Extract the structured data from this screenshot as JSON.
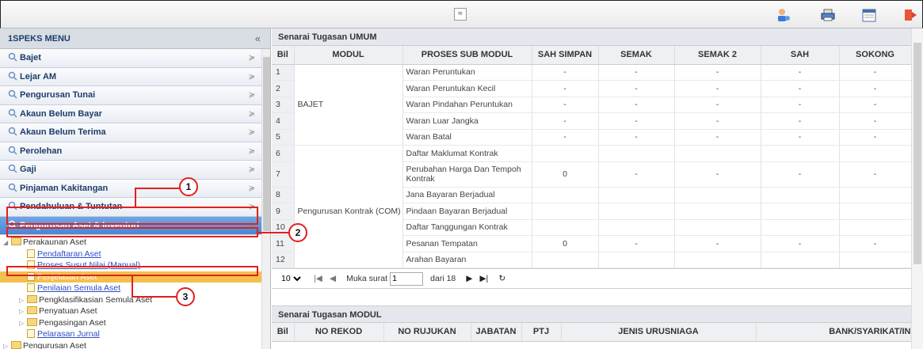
{
  "topbar": {
    "collapse_glyph": "≈",
    "icons": [
      "user-settings-icon",
      "printer-icon",
      "calendar-icon",
      "logout-icon"
    ]
  },
  "menu": {
    "title": "1SPEKS MENU",
    "collapse_glyph": "«",
    "chevron": "≽",
    "items": [
      {
        "label": "Bajet"
      },
      {
        "label": "Lejar AM"
      },
      {
        "label": "Pengurusan Tunai"
      },
      {
        "label": "Akaun Belum Bayar"
      },
      {
        "label": "Akaun Belum Terima"
      },
      {
        "label": "Perolehan"
      },
      {
        "label": "Gaji"
      },
      {
        "label": "Pinjaman Kakitangan"
      },
      {
        "label": "Pendahuluan & Tuntutan"
      },
      {
        "label": "Pengurusan Aset & Inventori",
        "active": true
      }
    ],
    "tree": [
      {
        "label": "Perakaunan Aset",
        "type": "folder",
        "level": 0,
        "open": true
      },
      {
        "label": "Pendaftaran Aset",
        "type": "link",
        "level": 1
      },
      {
        "label": "Proses Susut Nilai (Manual)",
        "type": "link",
        "level": 1
      },
      {
        "label": "Penjelasan Aset",
        "type": "link",
        "level": 1,
        "selected": true
      },
      {
        "label": "Penilaian Semula Aset",
        "type": "link",
        "level": 1
      },
      {
        "label": "Pengklasifikasian Semula Aset",
        "type": "folder",
        "level": 1
      },
      {
        "label": "Penyatuan Aset",
        "type": "folder",
        "level": 1
      },
      {
        "label": "Pengasingan Aset",
        "type": "folder",
        "level": 1
      },
      {
        "label": "Pelarasan Jurnal",
        "type": "link",
        "level": 1
      },
      {
        "label": "Pengurusan Aset",
        "type": "folder",
        "level": 0
      }
    ]
  },
  "umum": {
    "title": "Senarai Tugasan UMUM",
    "columns": [
      "Bil",
      "MODUL",
      "PROSES SUB MODUL",
      "SAH SIMPAN",
      "SEMAK",
      "SEMAK 2",
      "SAH",
      "SOKONG"
    ],
    "rows": [
      {
        "bil": "1",
        "proses": "Waran Peruntukan",
        "sah_simpan": "-",
        "semak": "-",
        "semak2": "-",
        "sah": "-",
        "sokong": "-"
      },
      {
        "bil": "2",
        "proses": "Waran Peruntukan Kecil",
        "sah_simpan": "-",
        "semak": "-",
        "semak2": "-",
        "sah": "-",
        "sokong": "-"
      },
      {
        "bil": "3",
        "modul": "BAJET",
        "proses": "Waran Pindahan Peruntukan",
        "sah_simpan": "-",
        "semak": "-",
        "semak2": "-",
        "sah": "-",
        "sokong": "-"
      },
      {
        "bil": "4",
        "proses": "Waran Luar Jangka",
        "sah_simpan": "-",
        "semak": "-",
        "semak2": "-",
        "sah": "-",
        "sokong": "-"
      },
      {
        "bil": "5",
        "proses": "Waran Batal",
        "sah_simpan": "-",
        "semak": "-",
        "semak2": "-",
        "sah": "-",
        "sokong": "-"
      },
      {
        "bil": "6",
        "proses": "Daftar Maklumat Kontrak"
      },
      {
        "bil": "7",
        "proses": "Perubahan Harga Dan Tempoh Kontrak",
        "sah_simpan": "0",
        "semak": "-",
        "semak2": "-",
        "sah": "-",
        "sokong": "-"
      },
      {
        "bil": "8",
        "proses": "Jana Bayaran Berjadual"
      },
      {
        "bil": "9",
        "modul": "Pengurusan Kontrak (COM)",
        "proses": "Pindaan Bayaran Berjadual"
      },
      {
        "bil": "10",
        "proses": "Daftar Tanggungan Kontrak"
      },
      {
        "bil": "11",
        "proses": "Pesanan Tempatan",
        "sah_simpan": "0",
        "semak": "-",
        "semak2": "-",
        "sah": "-",
        "sokong": "-"
      },
      {
        "bil": "12",
        "proses": "Arahan Bayaran"
      }
    ]
  },
  "pager": {
    "page_size": "10",
    "label_page": "Muka surat",
    "page": "1",
    "label_of": "dari 18"
  },
  "modul": {
    "title": "Senarai Tugasan MODUL",
    "columns": [
      "Bil",
      "NO REKOD",
      "NO RUJUKAN",
      "JABATAN",
      "PTJ",
      "JENIS URUSNIAGA",
      "BANK/SYARIKAT/IN"
    ]
  },
  "annotations": [
    "1",
    "2",
    "3"
  ]
}
